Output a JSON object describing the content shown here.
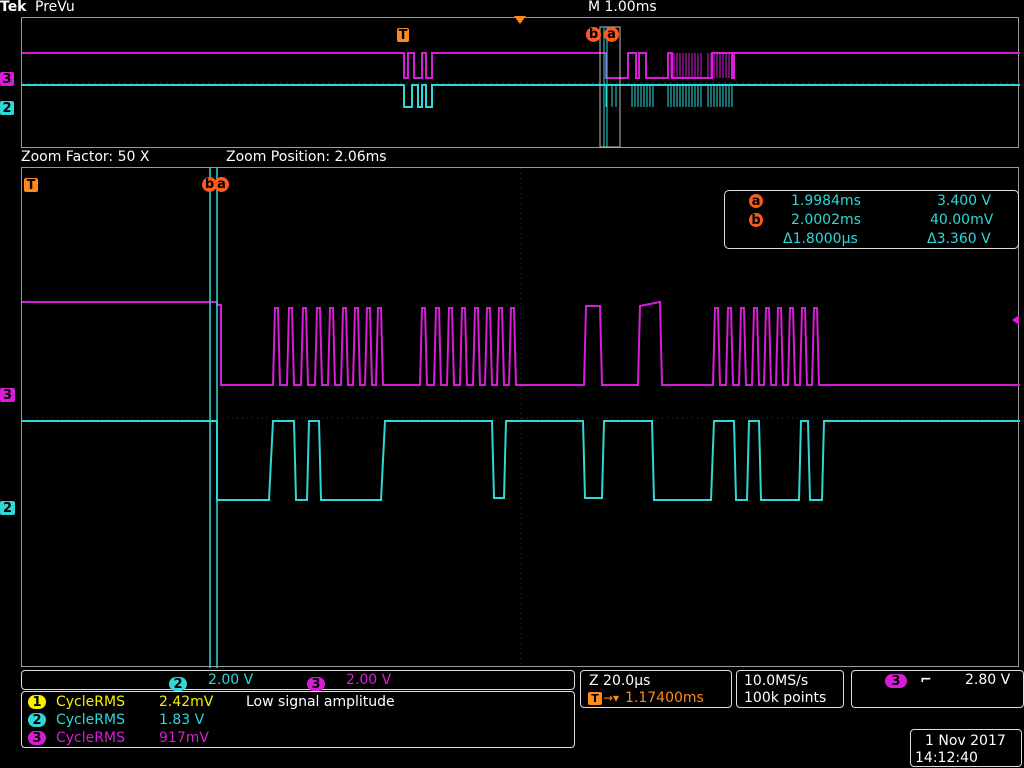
{
  "header": {
    "brand": "Tek",
    "mode": "PreVu",
    "timebase": "M 1.00ms"
  },
  "zoom": {
    "factor": "Zoom Factor: 50 X",
    "position": "Zoom Position: 2.06ms"
  },
  "markers": {
    "trigger": "T",
    "cursor_a": "a",
    "cursor_b": "b",
    "ch3": "3",
    "ch2": "2"
  },
  "cursor_readout": {
    "a_time": "1.9984ms",
    "a_value": "3.400 V",
    "b_time": "2.0002ms",
    "b_value": "40.00mV",
    "delta_time": "Δ1.8000µs",
    "delta_value": "Δ3.360 V"
  },
  "channel_scales": {
    "ch2_num": "2",
    "ch2_scale": "2.00 V",
    "ch3_num": "3",
    "ch3_scale": "2.00 V"
  },
  "measurements": [
    {
      "num": "1",
      "name": "CycleRMS",
      "value": "2.42mV",
      "note": "Low signal amplitude"
    },
    {
      "num": "2",
      "name": "CycleRMS",
      "value": "1.83 V",
      "note": ""
    },
    {
      "num": "3",
      "name": "CycleRMS",
      "value": "917mV",
      "note": ""
    }
  ],
  "horizontal": {
    "zoom_scale": "Z 20.0µs",
    "trigger_pos": "1.17400ms"
  },
  "acquisition": {
    "sample_rate": "10.0MS/s",
    "record_length": "100k points"
  },
  "trigger": {
    "source": "3",
    "slope_symbol": "⌐",
    "level": "2.80 V"
  },
  "datetime": {
    "date": "1 Nov 2017",
    "time": "14:12:40"
  },
  "colors": {
    "ch1": "#f6f100",
    "ch2": "#2fd7d7",
    "ch3": "#d81dd8",
    "cursor_marker": "#ff5a1c",
    "trigger_marker": "#ff8a1c"
  }
}
